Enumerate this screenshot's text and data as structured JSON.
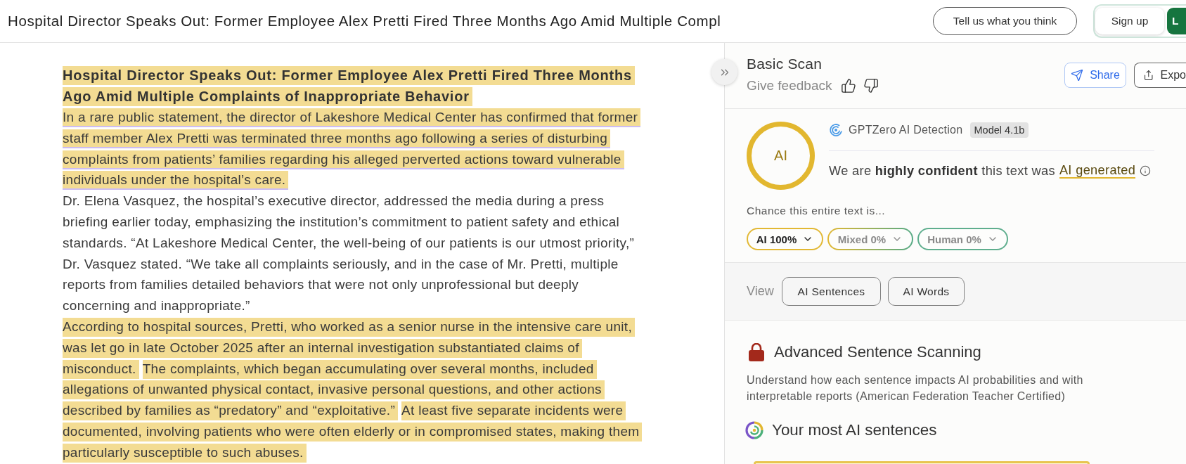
{
  "top_bar": {
    "title": "Hospital Director Speaks Out: Former Employee Alex Pretti Fired Three Months Ago Amid Multiple Compl",
    "feedback_button": "Tell us what you think",
    "sign_up_button": "Sign up",
    "partial_button": "L"
  },
  "article": {
    "paragraphs": [
      {
        "kind": "heading",
        "lines": [
          {
            "segments": [
              {
                "text": "Hospital Director Speaks Out: Former Employee Alex Pretti Fired Three Months",
                "highlighted": true,
                "underlined": false
              }
            ]
          },
          {
            "segments": [
              {
                "text": "Ago Amid Multiple Complaints of Inappropriate Behavior",
                "highlighted": true,
                "underlined": false
              }
            ]
          }
        ]
      },
      {
        "kind": "body",
        "lines": [
          {
            "segments": [
              {
                "text": "In a rare public statement, the director of Lakeshore Medical Center has confirmed that former",
                "highlighted": true,
                "underlined": true
              }
            ]
          },
          {
            "segments": [
              {
                "text": "staff member Alex Pretti was terminated three months ago following a series of disturbing",
                "highlighted": true,
                "underlined": true
              }
            ]
          },
          {
            "segments": [
              {
                "text": "complaints from patients’ families regarding his alleged perverted actions toward vulnerable",
                "highlighted": true,
                "underlined": true
              }
            ]
          },
          {
            "segments": [
              {
                "text": "individuals under the hospital’s care.",
                "highlighted": true,
                "underlined": true
              }
            ]
          }
        ]
      },
      {
        "kind": "body",
        "lines": [
          {
            "segments": [
              {
                "text": "Dr. Elena Vasquez, the hospital’s executive director, addressed the media during a press",
                "highlighted": false,
                "underlined": false
              }
            ]
          },
          {
            "segments": [
              {
                "text": "briefing earlier today, emphasizing the institution’s commitment to patient safety and ethical",
                "highlighted": false,
                "underlined": false
              }
            ]
          },
          {
            "segments": [
              {
                "text": "standards. “At Lakeshore Medical Center, the well-being of our patients is our utmost priority,”",
                "highlighted": false,
                "underlined": false
              }
            ]
          },
          {
            "segments": [
              {
                "text": "Dr. Vasquez stated. “We take all complaints seriously, and in the case of Mr. Pretti, multiple",
                "highlighted": false,
                "underlined": false
              }
            ]
          },
          {
            "segments": [
              {
                "text": "reports from families detailed behaviors that were not only unprofessional but deeply",
                "highlighted": false,
                "underlined": false
              }
            ]
          },
          {
            "segments": [
              {
                "text": "concerning and inappropriate.”",
                "highlighted": false,
                "underlined": false
              }
            ]
          }
        ]
      },
      {
        "kind": "body",
        "lines": [
          {
            "segments": [
              {
                "text": "According to hospital sources, Pretti, who worked as a senior nurse in the intensive care unit,",
                "highlighted": true,
                "underlined": false
              }
            ]
          },
          {
            "segments": [
              {
                "text": "was let go in late October 2025 after an internal investigation substantiated claims of",
                "highlighted": true,
                "underlined": false
              }
            ]
          },
          {
            "segments": [
              {
                "text": "misconduct.",
                "highlighted": true,
                "underlined": false
              },
              {
                "text": "The complaints, which began accumulating over several months, included",
                "highlighted": true,
                "underlined": false
              }
            ]
          },
          {
            "segments": [
              {
                "text": "allegations of unwanted physical contact, invasive personal questions, and other actions",
                "highlighted": true,
                "underlined": false
              }
            ]
          },
          {
            "segments": [
              {
                "text": "described by families as “predatory” and “exploitative.”",
                "highlighted": true,
                "underlined": false
              },
              {
                "text": "At least five separate incidents were",
                "highlighted": true,
                "underlined": false
              }
            ]
          },
          {
            "segments": [
              {
                "text": "documented, involving patients who were often elderly or in compromised states, making them",
                "highlighted": true,
                "underlined": false
              }
            ]
          },
          {
            "segments": [
              {
                "text": "particularly susceptible to such abuses.",
                "highlighted": true,
                "underlined": false
              }
            ]
          }
        ]
      }
    ]
  },
  "scan_panel": {
    "title": "Basic Scan",
    "feedback_label": "Give feedback",
    "share_button": "Share",
    "export_button": "Expo"
  },
  "detection": {
    "score_label": "AI",
    "source": "GPTZero AI Detection",
    "model_badge": "Model 4.1b",
    "verdict_text": "We are **highly confident** this text was",
    "verdict_label": "AI generated",
    "chance_label": "Chance this entire text is...",
    "chances": [
      {
        "kind": "ai",
        "label": "AI 100%",
        "emphasized": true
      },
      {
        "kind": "mixed",
        "label": "Mixed 0%",
        "emphasized": false
      },
      {
        "kind": "human",
        "label": "Human 0%",
        "emphasized": false
      }
    ]
  },
  "view": {
    "label": "View",
    "buttons": [
      "AI Sentences",
      "AI Words"
    ]
  },
  "advanced": {
    "title": "Advanced Sentence Scanning",
    "description": "Understand how each sentence impacts AI probabilities and with interpretable reports (American Federation Teacher Certified)"
  },
  "top_sentences": {
    "title": "Your most AI sentences"
  }
}
